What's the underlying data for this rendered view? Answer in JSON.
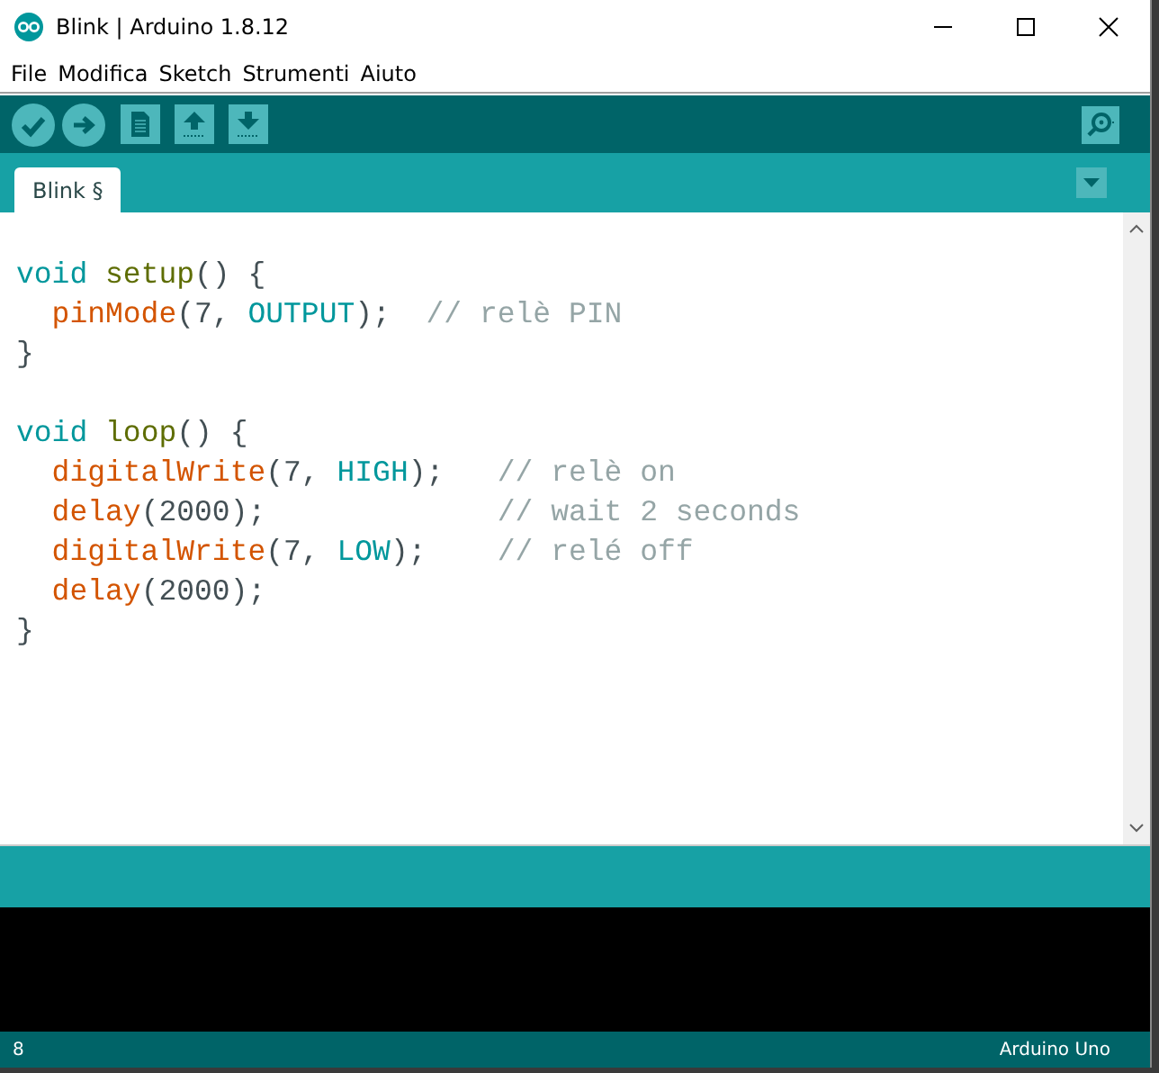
{
  "window": {
    "title": "Blink | Arduino 1.8.12"
  },
  "menu": [
    "File",
    "Modifica",
    "Sketch",
    "Strumenti",
    "Aiuto"
  ],
  "toolbar": [
    {
      "kind": "verify"
    },
    {
      "kind": "upload"
    },
    {
      "kind": "new"
    },
    {
      "kind": "open"
    },
    {
      "kind": "save"
    }
  ],
  "tabs": [
    {
      "label": "Blink §",
      "selected": true
    }
  ],
  "code": [
    {
      "kind": "code",
      "indented": false,
      "tokens": [
        {
          "kind": "type",
          "text": "void "
        },
        {
          "kind": "struct",
          "text": "setup"
        },
        {
          "kind": "plain",
          "text": "() {"
        }
      ]
    },
    {
      "kind": "code",
      "indented": true,
      "tokens": [
        {
          "kind": "func",
          "text": "pinMode"
        },
        {
          "kind": "plain",
          "text": "(7, "
        },
        {
          "kind": "const",
          "text": "OUTPUT"
        },
        {
          "kind": "plain",
          "text": ");  "
        },
        {
          "kind": "comment",
          "text": "// relè PIN"
        }
      ]
    },
    {
      "kind": "code",
      "indented": false,
      "tokens": [
        {
          "kind": "plain",
          "text": "}"
        }
      ]
    },
    {
      "kind": "blank"
    },
    {
      "kind": "code",
      "indented": false,
      "tokens": [
        {
          "kind": "type",
          "text": "void "
        },
        {
          "kind": "struct",
          "text": "loop"
        },
        {
          "kind": "plain",
          "text": "() {"
        }
      ]
    },
    {
      "kind": "code",
      "indented": true,
      "tokens": [
        {
          "kind": "func",
          "text": "digitalWrite"
        },
        {
          "kind": "plain",
          "text": "(7, "
        },
        {
          "kind": "const",
          "text": "HIGH"
        },
        {
          "kind": "plain",
          "text": ");   "
        },
        {
          "kind": "comment",
          "text": "// relè on"
        }
      ]
    },
    {
      "kind": "code",
      "indented": true,
      "tokens": [
        {
          "kind": "func",
          "text": "delay"
        },
        {
          "kind": "plain",
          "text": "(2000);             "
        },
        {
          "kind": "comment",
          "text": "// wait 2 seconds"
        }
      ]
    },
    {
      "kind": "code",
      "indented": true,
      "tokens": [
        {
          "kind": "func",
          "text": "digitalWrite"
        },
        {
          "kind": "plain",
          "text": "(7, "
        },
        {
          "kind": "const",
          "text": "LOW"
        },
        {
          "kind": "plain",
          "text": ");    "
        },
        {
          "kind": "comment",
          "text": "// relé off"
        }
      ]
    },
    {
      "kind": "code",
      "indented": true,
      "tokens": [
        {
          "kind": "func",
          "text": "delay"
        },
        {
          "kind": "plain",
          "text": "(2000);"
        }
      ]
    },
    {
      "kind": "code",
      "indented": false,
      "tokens": [
        {
          "kind": "plain",
          "text": "}"
        }
      ]
    }
  ],
  "status_bar": {
    "line": "8",
    "board": "Arduino Uno"
  }
}
